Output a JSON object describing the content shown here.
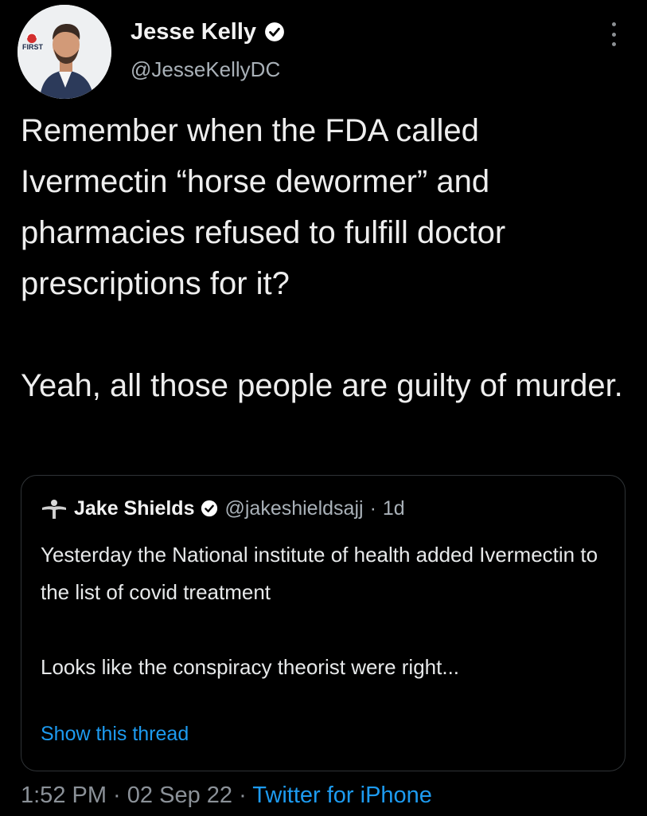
{
  "tweet": {
    "author": {
      "name": "Jesse Kelly",
      "handle": "@JesseKellyDC",
      "avatar_badge_text": "FIRST"
    },
    "body": {
      "paragraph_1": "Remember when the FDA called Ivermectin “horse dewormer” and pharmacies refused to fulfill doctor prescriptions for it?",
      "paragraph_2": "Yeah, all those people are guilty of murder."
    },
    "quoted": {
      "author_name": "Jake Shields",
      "author_handle": "@jakeshieldsajj",
      "separator": "·",
      "time": "1d",
      "paragraph_1": "Yesterday the National institute of health added Ivermectin to the list of covid treatment",
      "paragraph_2": "Looks like the conspiracy theorist were right...",
      "show_thread_label": "Show this thread"
    },
    "meta": {
      "time": "1:52 PM",
      "sep1": " · ",
      "date": "02 Sep 22",
      "sep2": " · ",
      "source": "Twitter for iPhone"
    }
  },
  "icons": {
    "verified": "verified-badge-icon",
    "more": "more-options-icon"
  },
  "colors": {
    "background": "#000000",
    "text": "#e7e9ea",
    "secondary_text": "#a9b1b8",
    "link": "#1d9bf0",
    "border": "#2f3336",
    "badge_red": "#d32f2f"
  }
}
